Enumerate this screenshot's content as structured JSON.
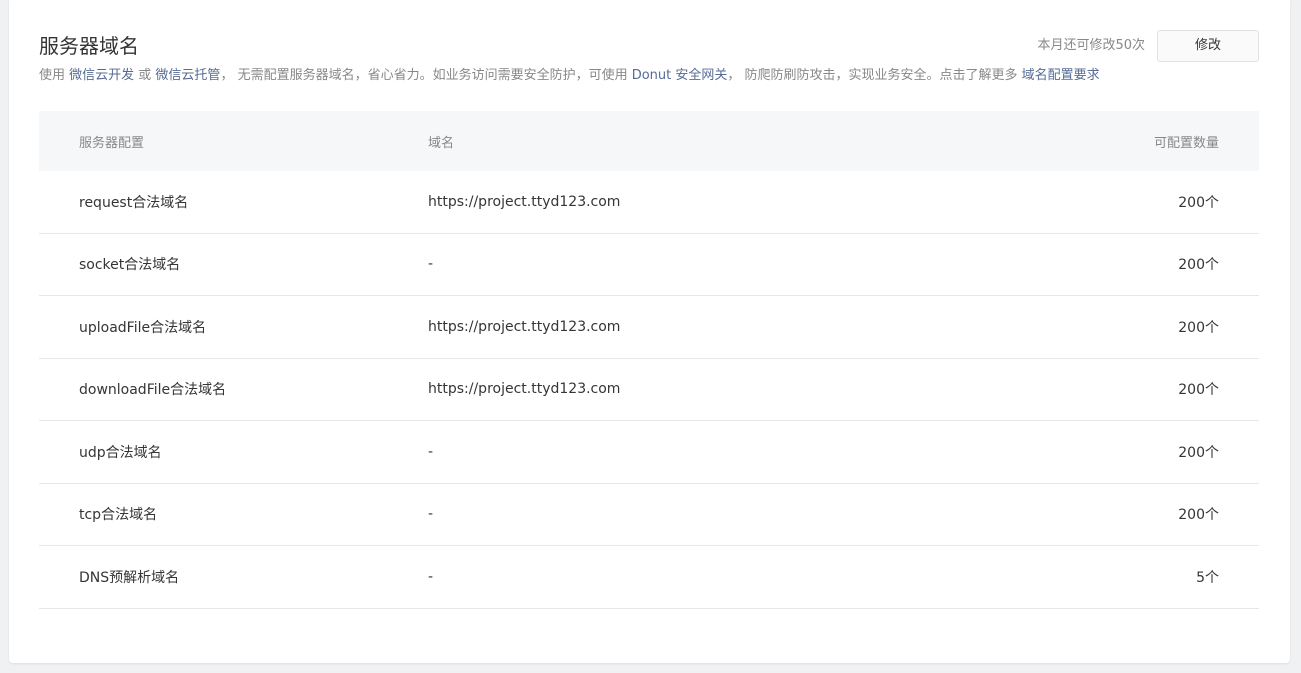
{
  "section": {
    "title": "服务器域名",
    "quota_text": "本月还可修改50次",
    "modify_label": "修改"
  },
  "description": {
    "p1": "使用 ",
    "link1": "微信云开发",
    "p2": " 或 ",
    "link2": "微信云托管",
    "p3": "， 无需配置服务器域名，省心省力。如业务访问需要安全防护，可使用 ",
    "link3": "Donut 安全网关",
    "p4": "， 防爬防刷防攻击，实现业务安全。点击了解更多 ",
    "link4": "域名配置要求"
  },
  "table": {
    "headers": [
      "服务器配置",
      "域名",
      "可配置数量"
    ],
    "rows": [
      {
        "config": "request合法域名",
        "domain": "https://project.ttyd123.com",
        "count": "200个"
      },
      {
        "config": "socket合法域名",
        "domain": "-",
        "count": "200个"
      },
      {
        "config": "uploadFile合法域名",
        "domain": "https://project.ttyd123.com",
        "count": "200个"
      },
      {
        "config": "downloadFile合法域名",
        "domain": "https://project.ttyd123.com",
        "count": "200个"
      },
      {
        "config": "udp合法域名",
        "domain": "-",
        "count": "200个"
      },
      {
        "config": "tcp合法域名",
        "domain": "-",
        "count": "200个"
      },
      {
        "config": "DNS预解析域名",
        "domain": "-",
        "count": "5个"
      }
    ]
  },
  "colors": {
    "link": "#576b95",
    "muted": "#888888",
    "text": "#353535",
    "header_bg": "#f6f7f9"
  }
}
